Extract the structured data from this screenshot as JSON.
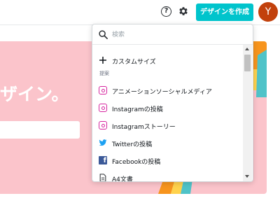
{
  "header": {
    "help_icon": "question-circle-icon",
    "help_glyph": "?",
    "settings_icon": "gear-icon",
    "create_button_label": "デザインを作成",
    "avatar_initial": "Y"
  },
  "hero": {
    "title_fragment": "ザイン。"
  },
  "dropdown": {
    "search_placeholder": "検索",
    "custom_size_label": "カスタムサイズ",
    "section_label": "提案",
    "items": [
      {
        "label": "アニメーションソーシャルメディア",
        "icon": "instagram-icon"
      },
      {
        "label": "Instagramの投稿",
        "icon": "instagram-icon"
      },
      {
        "label": "Instagramストーリー",
        "icon": "instagram-icon"
      },
      {
        "label": "Twitterの投稿",
        "icon": "twitter-icon"
      },
      {
        "label": "Facebookの投稿",
        "icon": "facebook-icon"
      },
      {
        "label": "A4文書",
        "icon": "document-icon"
      }
    ]
  },
  "colors": {
    "accent": "#00c4cc",
    "avatar": "#c2410c",
    "hero_bg": "#fbc4cb",
    "instagram": "#d6249f",
    "twitter": "#1da1f2",
    "facebook": "#3b5998"
  }
}
